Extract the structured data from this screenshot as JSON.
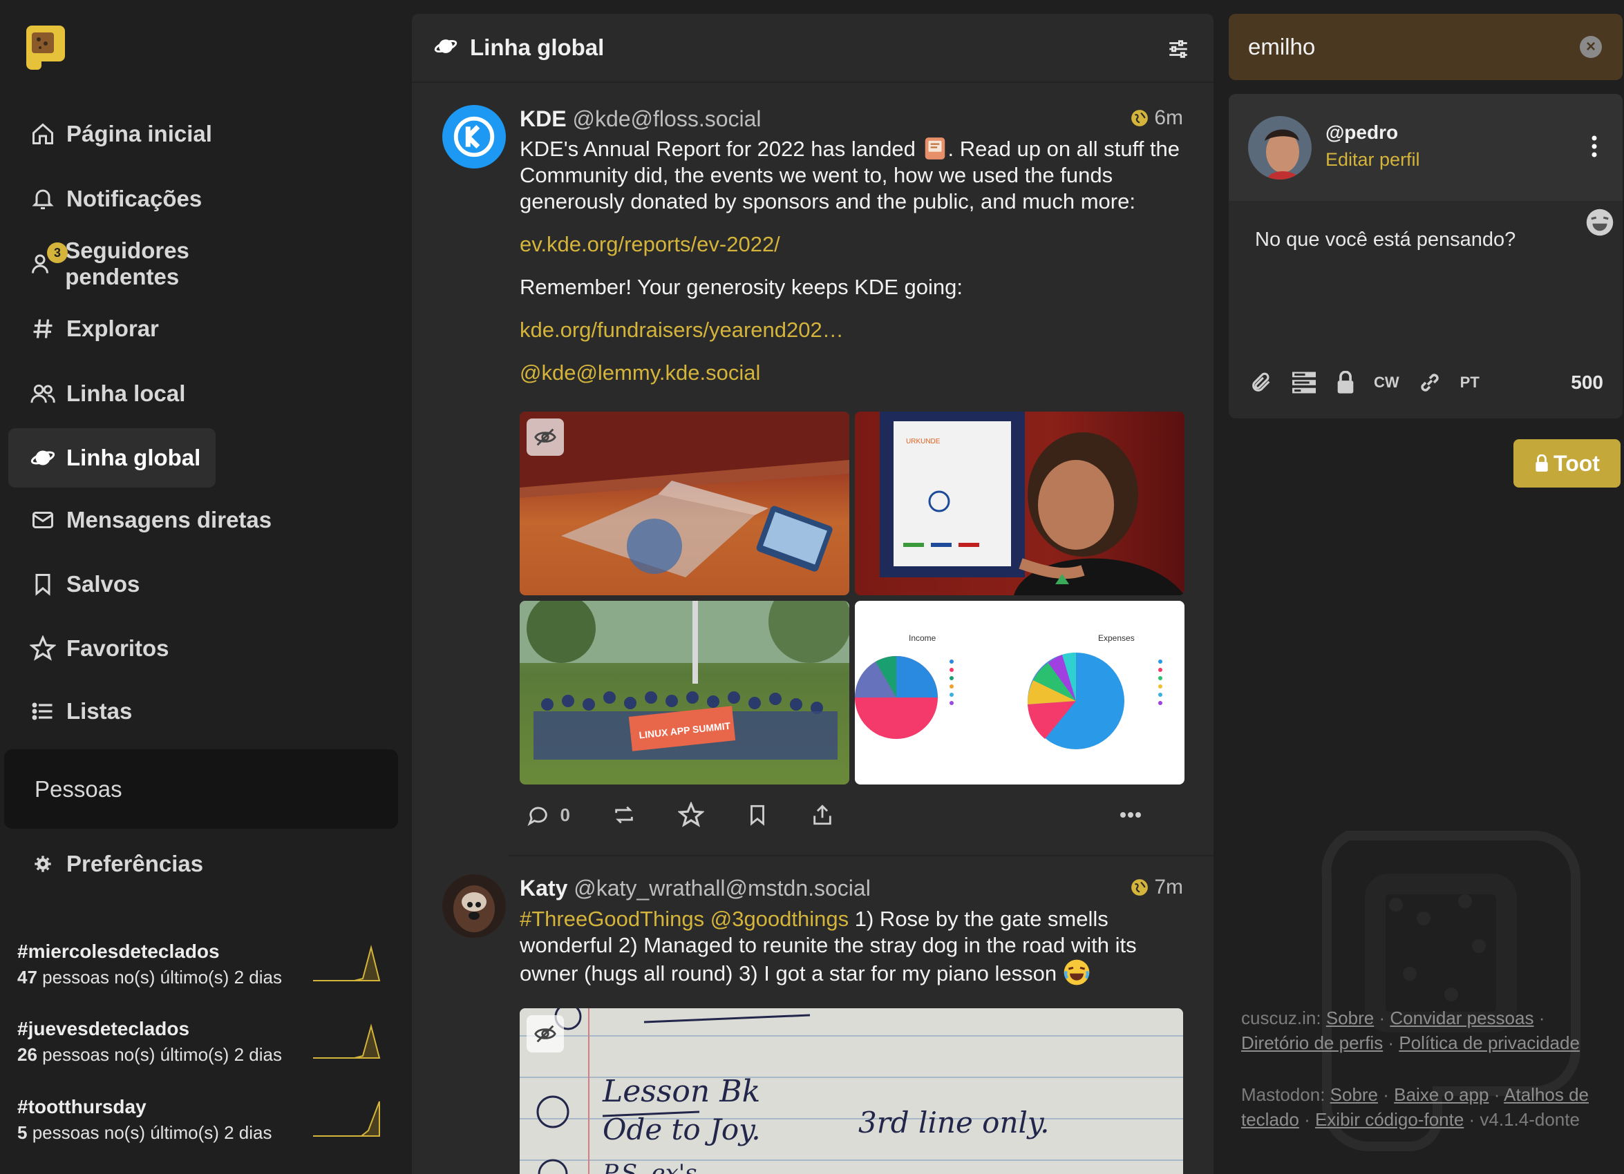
{
  "app": {
    "brand_color": "#d4b43a",
    "logo_icon": "elephant-logo-icon"
  },
  "nav": [
    {
      "label": "Página inicial",
      "icon": "home-icon"
    },
    {
      "label": "Notificações",
      "icon": "bell-icon"
    },
    {
      "label": "Seguidores pendentes",
      "icon": "user-add-icon",
      "badge": "3"
    },
    {
      "label": "Explorar",
      "icon": "hashtag-icon"
    },
    {
      "label": "Linha local",
      "icon": "users-icon"
    },
    {
      "label": "Linha global",
      "icon": "planet-icon",
      "active": true
    },
    {
      "label": "Mensagens diretas",
      "icon": "envelope-icon"
    },
    {
      "label": "Salvos",
      "icon": "bookmark-icon"
    },
    {
      "label": "Favoritos",
      "icon": "star-icon"
    },
    {
      "label": "Listas",
      "icon": "list-icon"
    }
  ],
  "people_label": "Pessoas",
  "preferences_label": "Preferências",
  "trends": [
    {
      "tag": "#miercolesdeteclados",
      "count": "47",
      "suffix": " pessoas no(s) último(s) 2 dias"
    },
    {
      "tag": "#juevesdeteclados",
      "count": "26",
      "suffix": " pessoas no(s) último(s) 2 dias"
    },
    {
      "tag": "#tootthursday",
      "count": "5",
      "suffix": " pessoas no(s) último(s) 2 dias"
    }
  ],
  "column": {
    "title": "Linha global"
  },
  "posts": [
    {
      "name": "KDE",
      "handle": "@kde@floss.social",
      "time": "6m",
      "text1": "KDE's Annual Report for 2022 has landed",
      "text1b": ". Read up on all stuff the Community did, the events we went to, how we used the funds generously donated by sponsors and the public, and much more:",
      "link1": "ev.kde.org/reports/ev-2022/",
      "text2": "Remember! Your generosity keeps KDE going:",
      "link2": "kde.org/fundraisers/yearend202…",
      "mention": "@kde@lemmy.kde.social",
      "replies": "0",
      "chart_income": "Income",
      "chart_expenses": "Expenses",
      "banner": "LINUX APP SUMMIT",
      "doc_title": "URKUNDE"
    },
    {
      "name": "Katy",
      "handle": "@katy_wrathall@mstdn.social",
      "time": "7m",
      "hashtag": "#ThreeGoodThings",
      "mention": "@3goodthings",
      "text": " 1) Rose by the gate smells wonderful 2) Managed to reunite the stray dog in the road with its owner (hugs all round) 3) I got a star for my piano lesson",
      "note1": "Lesson Bk",
      "note2": "Ode to Joy.",
      "note3": "3rd line only."
    }
  ],
  "search": {
    "value": "emilho"
  },
  "compose": {
    "handle": "@pedro",
    "edit_label": "Editar perfil",
    "placeholder": "No que você está pensando?",
    "cw": "CW",
    "lang": "PT",
    "count": "500",
    "toot_label": "Toot"
  },
  "footer": {
    "instance": "cuscuz.in",
    "about": "Sobre",
    "invite": "Convidar pessoas",
    "directory": "Diretório de perfis",
    "privacy": "Política de privacidade",
    "mastodon": "Mastodon",
    "about2": "Sobre",
    "app": "Baixe o app",
    "shortcuts": "Atalhos de teclado",
    "source": "Exibir código-fonte",
    "version": "v4.1.4-donte"
  }
}
